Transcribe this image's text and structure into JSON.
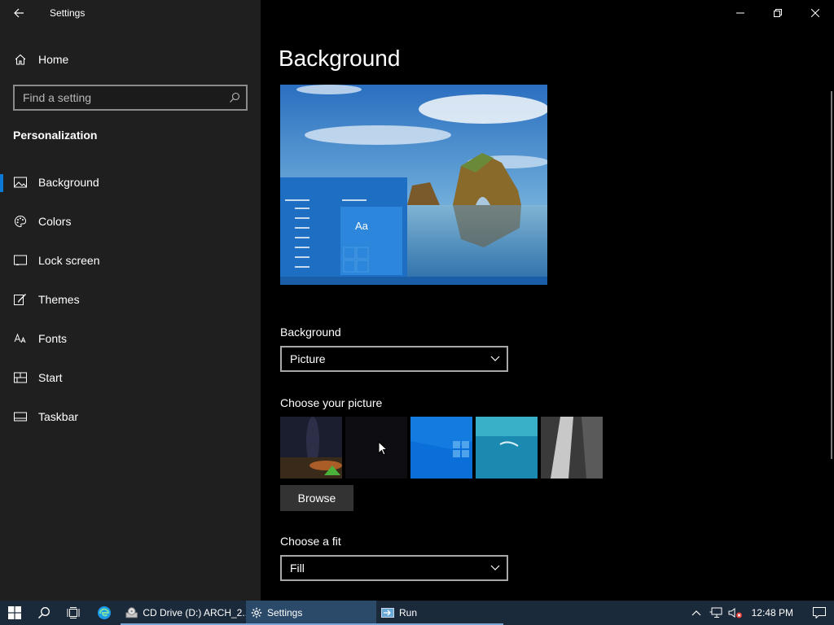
{
  "window": {
    "title": "Settings",
    "controls": [
      "minimize",
      "restore",
      "close"
    ]
  },
  "sidebar": {
    "home_label": "Home",
    "search": {
      "placeholder": "Find a setting",
      "value": ""
    },
    "section_title": "Personalization",
    "items": [
      {
        "label": "Background",
        "icon": "picture-icon",
        "selected": true
      },
      {
        "label": "Colors",
        "icon": "palette-icon",
        "selected": false
      },
      {
        "label": "Lock screen",
        "icon": "lock-screen-icon",
        "selected": false
      },
      {
        "label": "Themes",
        "icon": "brush-icon",
        "selected": false
      },
      {
        "label": "Fonts",
        "icon": "fonts-icon",
        "selected": false
      },
      {
        "label": "Start",
        "icon": "start-icon",
        "selected": false
      },
      {
        "label": "Taskbar",
        "icon": "taskbar-icon",
        "selected": false
      }
    ]
  },
  "main": {
    "page_title": "Background",
    "preview": {
      "sample_text": "Aa"
    },
    "background_label": "Background",
    "background_value": "Picture",
    "choose_picture_label": "Choose your picture",
    "browse_label": "Browse",
    "fit_label": "Choose a fit",
    "fit_value": "Fill"
  },
  "taskbar": {
    "apps": [
      {
        "label": "CD Drive (D:) ARCH_2...",
        "icon": "cd-drive-icon",
        "active": false
      },
      {
        "label": "Settings",
        "icon": "gear-icon",
        "active": true
      },
      {
        "label": "Run",
        "icon": "run-icon",
        "active": false
      }
    ],
    "clock": "12:48 PM"
  },
  "colors": {
    "accent": "#0a7ad6",
    "sidebar_bg": "#1f1f1f",
    "taskbar_bg": "#1b2a3a"
  }
}
